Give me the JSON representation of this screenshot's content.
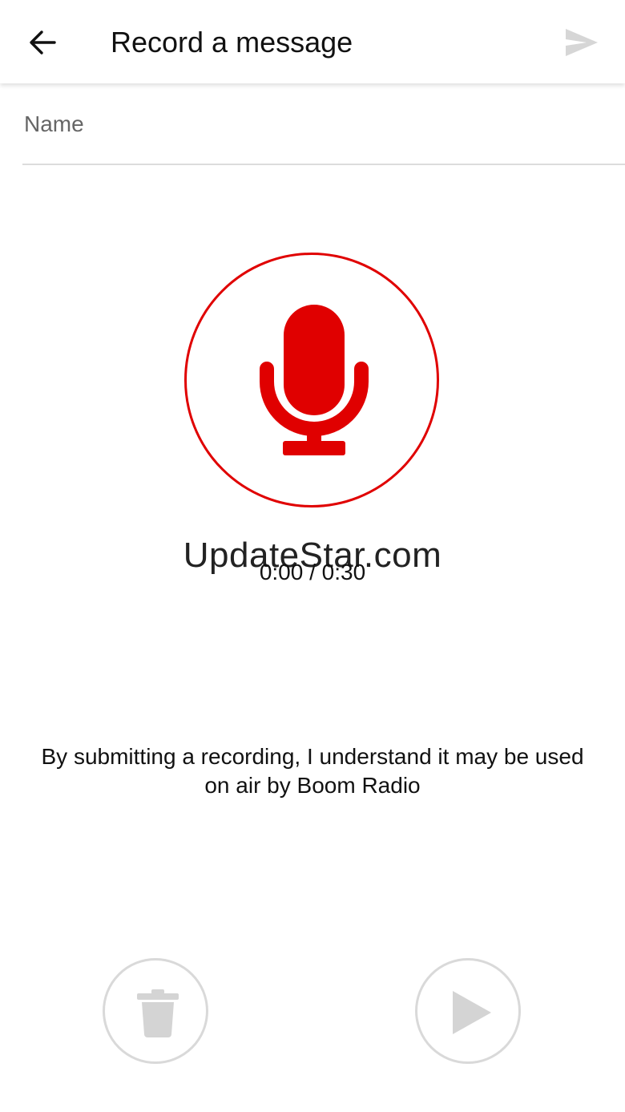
{
  "app_bar": {
    "title": "Record a message",
    "back_icon": "arrow-back-icon",
    "send_icon": "send-icon"
  },
  "form": {
    "name_placeholder": "Name",
    "name_value": ""
  },
  "recorder": {
    "mic_icon": "microphone-icon",
    "accent_color": "#e00000",
    "timer": "0:00 / 0:30"
  },
  "watermark": "UpdateStar.com",
  "disclaimer": "By submitting a recording, I understand it may be used on air by Boom Radio",
  "controls": {
    "delete_icon": "trash-icon",
    "play_icon": "play-icon",
    "disabled_color": "#d9d9d9"
  }
}
